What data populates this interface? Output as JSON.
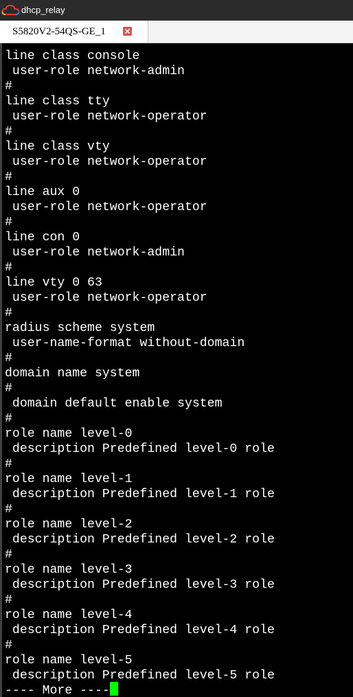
{
  "window": {
    "title": "dhcp_relay",
    "app_icon": "cloud-icon"
  },
  "tabs": [
    {
      "label": "S5820V2-54QS-GE_1",
      "active": true
    }
  ],
  "terminal": {
    "lines": [
      "line class console",
      " user-role network-admin",
      "#",
      "line class tty",
      " user-role network-operator",
      "#",
      "line class vty",
      " user-role network-operator",
      "#",
      "line aux 0",
      " user-role network-operator",
      "#",
      "line con 0",
      " user-role network-admin",
      "#",
      "line vty 0 63",
      " user-role network-operator",
      "#",
      "radius scheme system",
      " user-name-format without-domain",
      "#",
      "domain name system",
      "#",
      " domain default enable system",
      "#",
      "role name level-0",
      " description Predefined level-0 role",
      "#",
      "role name level-1",
      " description Predefined level-1 role",
      "#",
      "role name level-2",
      " description Predefined level-2 role",
      "#",
      "role name level-3",
      " description Predefined level-3 role",
      "#",
      "role name level-4",
      " description Predefined level-4 role",
      "#",
      "role name level-5",
      " description Predefined level-5 role"
    ],
    "more_prompt": "---- More ----",
    "cursor_color": "#00ff00",
    "background": "#000000",
    "foreground": "#ffffff"
  },
  "colors": {
    "titlebar": "#2b2b2b",
    "tab_close_accent": "#d9534f"
  }
}
